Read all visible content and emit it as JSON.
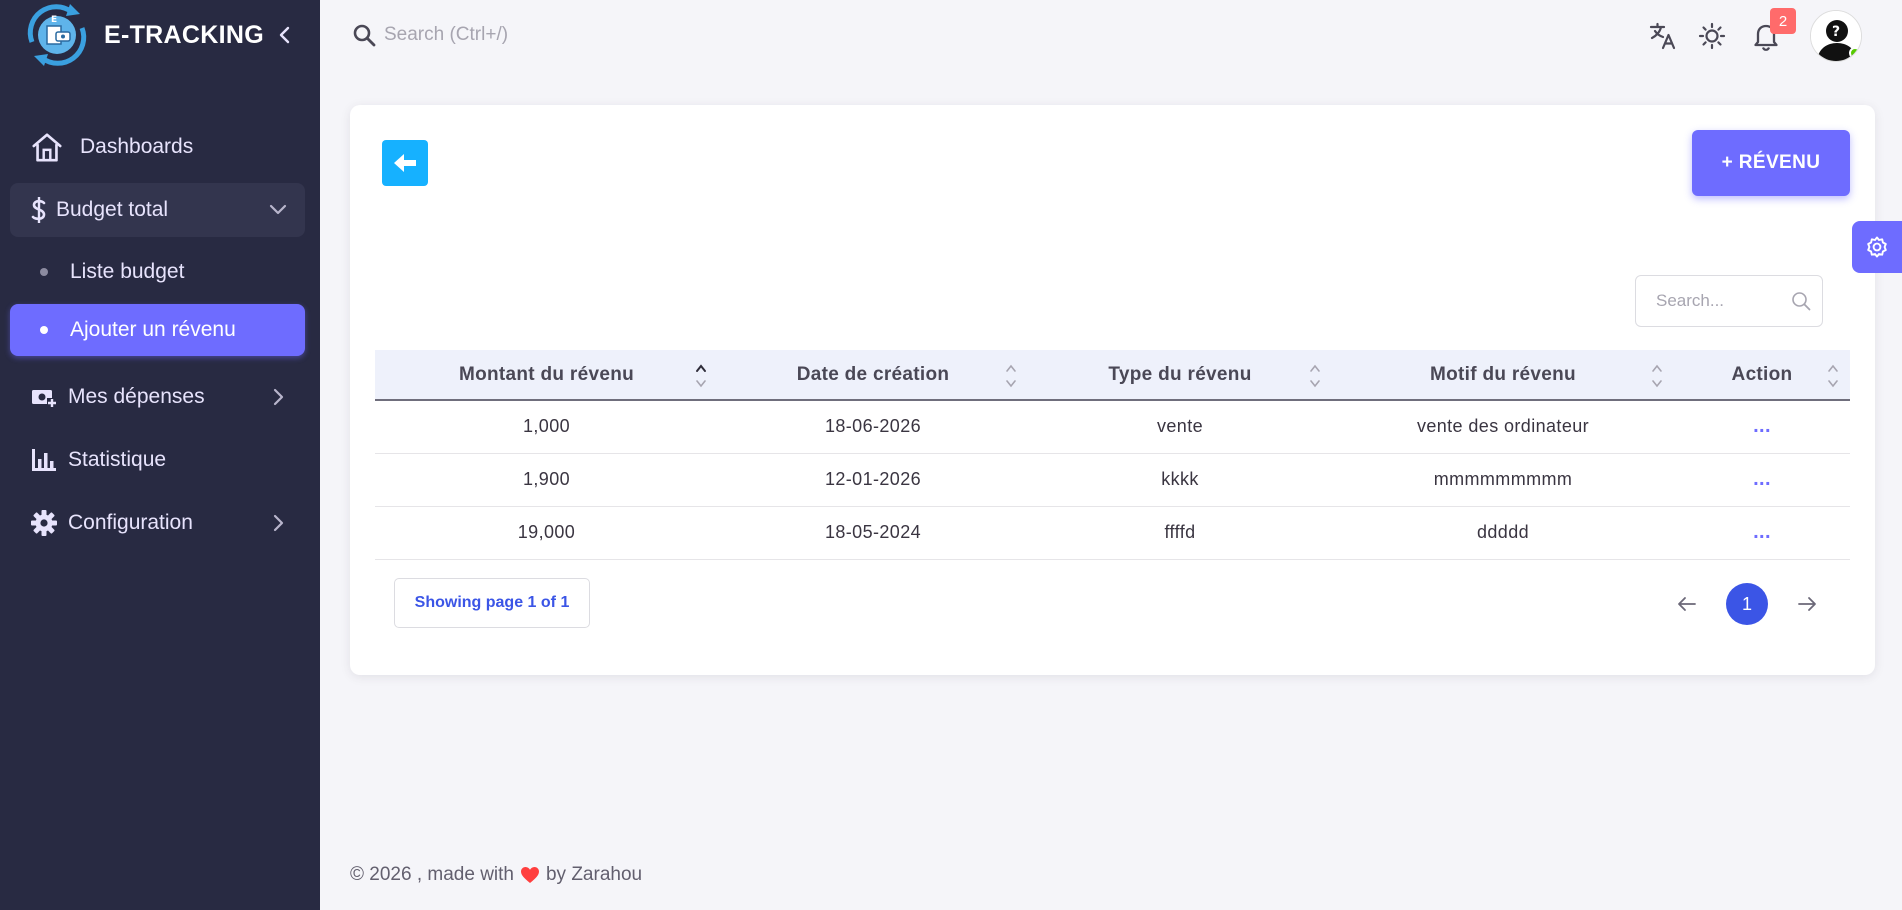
{
  "brand": {
    "name": "E-TRACKING"
  },
  "sidebar": {
    "items": [
      {
        "label": "Dashboards"
      },
      {
        "label": "Budget total"
      },
      {
        "label": "Liste budget"
      },
      {
        "label": "Ajouter un révenu"
      },
      {
        "label": "Mes dépenses"
      },
      {
        "label": "Statistique"
      },
      {
        "label": "Configuration"
      }
    ]
  },
  "topbar": {
    "search_placeholder": "Search (Ctrl+/)",
    "notification_count": "2"
  },
  "card": {
    "add_button_label": "+ RÉVENU",
    "search_placeholder": "Search...",
    "table": {
      "columns": [
        "Montant du révenu",
        "Date de création",
        "Type du révenu",
        "Motif du révenu",
        "Action"
      ],
      "rows": [
        [
          "1,000",
          "18-06-2026",
          "vente",
          "vente des ordinateur",
          "..."
        ],
        [
          "1,900",
          "12-01-2026",
          "kkkk",
          "mmmmmmmmm",
          "..."
        ],
        [
          "19,000",
          "18-05-2024",
          "ffffd",
          "ddddd",
          "..."
        ]
      ]
    },
    "pagination": {
      "info": "Showing page 1 of 1",
      "current": "1"
    }
  },
  "footer": {
    "prefix": "© 2026 , made with",
    "suffix": "by Zarahou"
  },
  "colors": {
    "sidebar_bg": "#282a42",
    "primary": "#6e6cff",
    "info": "#16b1ff",
    "pager_active": "#3b55e6",
    "badge": "#ff6b6b"
  }
}
